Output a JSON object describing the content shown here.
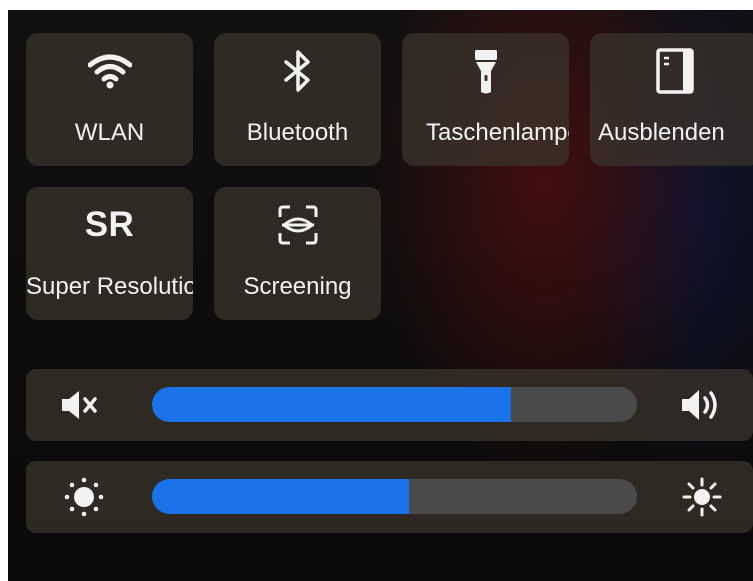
{
  "quick_settings": {
    "tiles": [
      {
        "label": "WLAN",
        "icon": "wifi-icon"
      },
      {
        "label": "Bluetooth",
        "icon": "bluetooth-icon"
      },
      {
        "label": "Taschenlampe",
        "icon": "flashlight-icon"
      },
      {
        "label": "Ausblenden",
        "icon": "hide-panel-icon"
      },
      {
        "label": "Super Resolution",
        "icon": "SR"
      },
      {
        "label": "Screening",
        "icon": "screening-icon"
      }
    ]
  },
  "sliders": {
    "volume": {
      "value_percent": 74,
      "min_icon": "volume-mute-icon",
      "max_icon": "volume-high-icon",
      "fill_color": "#1a73e8"
    },
    "brightness": {
      "value_percent": 53,
      "min_icon": "brightness-low-icon",
      "max_icon": "brightness-high-icon",
      "fill_color": "#1a73e8"
    }
  },
  "colors": {
    "accent": "#1a73e8",
    "tile_bg": "#3c342c",
    "text": "#f2f2f2"
  }
}
